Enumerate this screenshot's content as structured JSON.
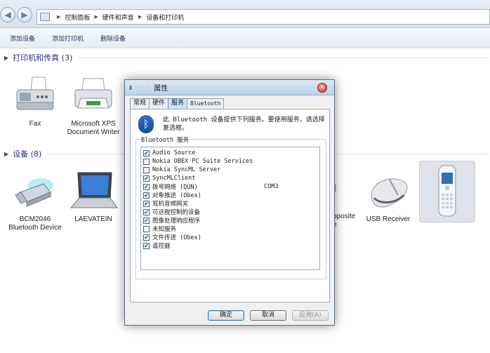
{
  "breadcrumb": [
    "控制面板",
    "硬件和声音",
    "设备和打印机"
  ],
  "toolbar": {
    "add_device": "添加设备",
    "add_printer": "添加打印机",
    "remove_device": "删除设备"
  },
  "groups": {
    "printers": {
      "title": "打印机和传真 (3)"
    },
    "devices": {
      "title": "设备 (8)"
    }
  },
  "printers": {
    "fax": "Fax",
    "xps": "Microsoft XPS Document Writer"
  },
  "devices": {
    "bcm": "BCM2046 Bluetooth Device",
    "laptop": "LAEVATEIN",
    "composite": "oposite",
    "composite_2": "e",
    "usb_receiver": "USB Receiver"
  },
  "dialog": {
    "title": "属性",
    "tabs": [
      "常规",
      "硬件",
      "服务",
      "Bluetooth"
    ],
    "description": "此 Bluetooth 设备提供下列服务。要使用服务，请选择复选框。",
    "group_label": "Bluetooth 服务",
    "services": [
      {
        "name": "Audio Source",
        "checked": true,
        "port": ""
      },
      {
        "name": "Nokia OBEX PC Suite Services",
        "checked": false,
        "port": ""
      },
      {
        "name": "Nokia SyncML Server",
        "checked": false,
        "port": ""
      },
      {
        "name": "SyncMLClient",
        "checked": true,
        "port": ""
      },
      {
        "name": "拨号网络 (DUN)",
        "checked": true,
        "port": "COM3"
      },
      {
        "name": "对象推送 (Obex)",
        "checked": true,
        "port": ""
      },
      {
        "name": "耳机音频网关",
        "checked": true,
        "port": ""
      },
      {
        "name": "可远程控制的设备",
        "checked": true,
        "port": ""
      },
      {
        "name": "图像处理响应程序",
        "checked": true,
        "port": ""
      },
      {
        "name": "未知服务",
        "checked": false,
        "port": ""
      },
      {
        "name": "文件传送 (Obex)",
        "checked": true,
        "port": ""
      },
      {
        "name": "遥控器",
        "checked": true,
        "port": ""
      }
    ],
    "buttons": {
      "ok": "确定",
      "cancel": "取消",
      "apply": "应用(A)"
    }
  },
  "icons": [
    "back-icon",
    "forward-icon",
    "control-panel-icon",
    "fax-icon",
    "printer-icon",
    "usb-bluetooth-dongle-icon",
    "laptop-icon",
    "webcam-icon",
    "mouse-icon",
    "mobile-phone-icon",
    "bluetooth-icon",
    "close-icon"
  ]
}
